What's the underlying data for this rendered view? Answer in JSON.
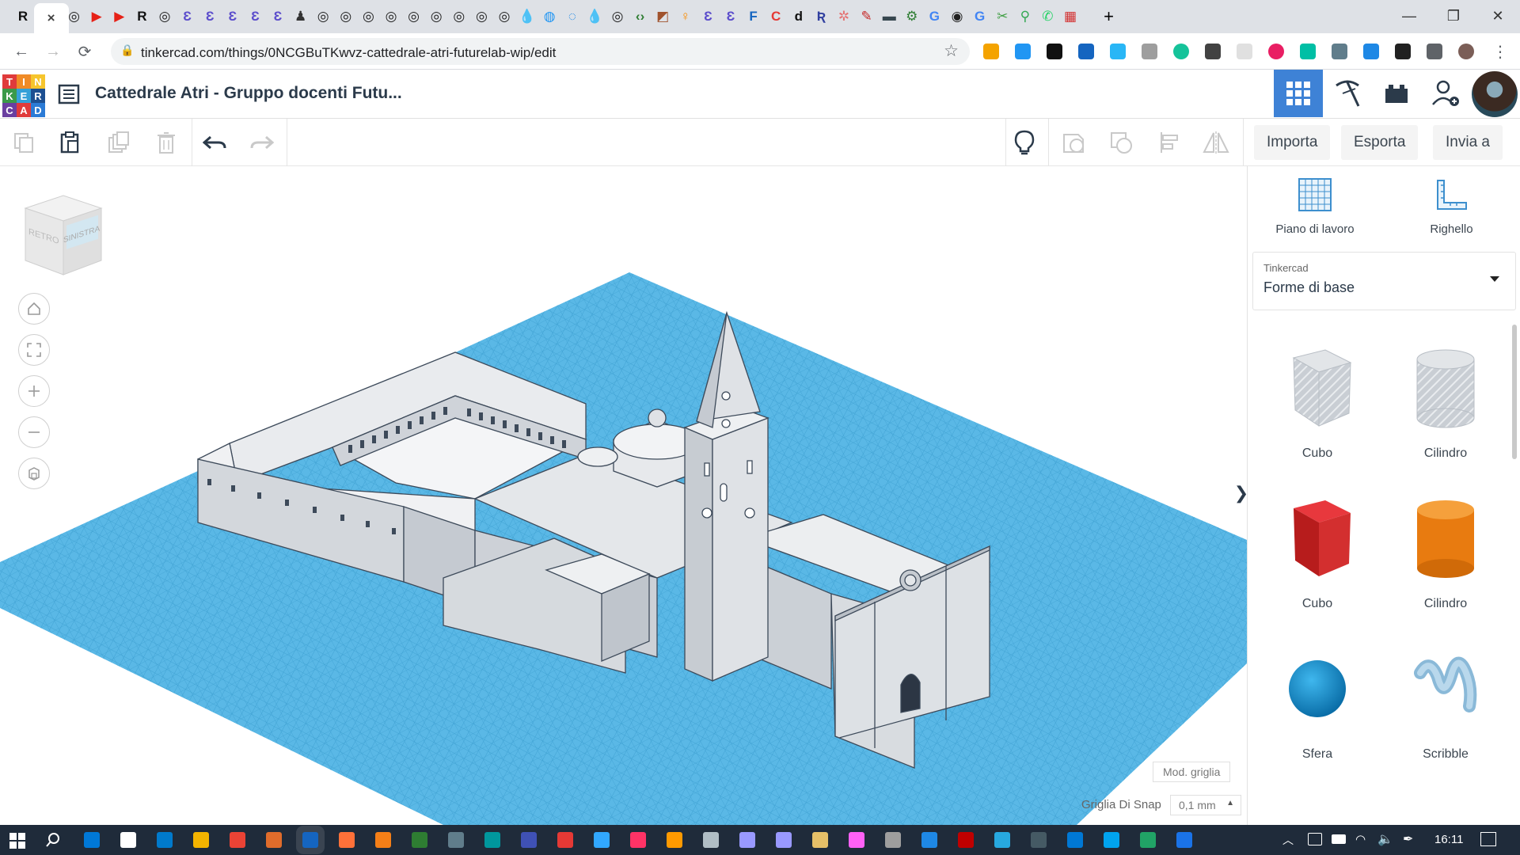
{
  "browser": {
    "tabs": [
      {
        "label": "R",
        "color": "#111111"
      },
      {
        "label": "×",
        "color": "#444444",
        "active": true
      },
      {
        "label": "◎",
        "color": "#222222"
      },
      {
        "label": "▶",
        "color": "#e62117"
      },
      {
        "label": "▶",
        "color": "#e62117"
      },
      {
        "label": "R",
        "color": "#111111"
      },
      {
        "label": "◎",
        "color": "#222222"
      },
      {
        "label": "Ɛ",
        "color": "#5b4dcc"
      },
      {
        "label": "Ɛ",
        "color": "#5b4dcc"
      },
      {
        "label": "Ɛ",
        "color": "#5b4dcc"
      },
      {
        "label": "Ɛ",
        "color": "#5b4dcc"
      },
      {
        "label": "Ɛ",
        "color": "#5b4dcc"
      },
      {
        "label": "♟",
        "color": "#333333"
      },
      {
        "label": "◎",
        "color": "#222222"
      },
      {
        "label": "◎",
        "color": "#222222"
      },
      {
        "label": "◎",
        "color": "#222222"
      },
      {
        "label": "◎",
        "color": "#222222"
      },
      {
        "label": "◎",
        "color": "#222222"
      },
      {
        "label": "◎",
        "color": "#222222"
      },
      {
        "label": "◎",
        "color": "#222222"
      },
      {
        "label": "◎",
        "color": "#222222"
      },
      {
        "label": "◎",
        "color": "#222222"
      },
      {
        "label": "💧",
        "color": "#1e88e5"
      },
      {
        "label": "◍",
        "color": "#2196f3"
      },
      {
        "label": "◌",
        "color": "#1e88e5"
      },
      {
        "label": "💧",
        "color": "#1e88e5"
      },
      {
        "label": "◎",
        "color": "#222222"
      },
      {
        "label": "‹›",
        "color": "#2e7d32"
      },
      {
        "label": "◩",
        "color": "#a0522d"
      },
      {
        "label": "♀",
        "color": "#fb8c00"
      },
      {
        "label": "Ɛ",
        "color": "#5b4dcc"
      },
      {
        "label": "Ɛ",
        "color": "#5b4dcc"
      },
      {
        "label": "F",
        "color": "#1565c0"
      },
      {
        "label": "C",
        "color": "#e53935"
      },
      {
        "label": "d",
        "color": "#111111"
      },
      {
        "label": "Ʀ",
        "color": "#303f9f"
      },
      {
        "label": "✲",
        "color": "#e57373"
      },
      {
        "label": "✎",
        "color": "#c62828"
      },
      {
        "label": "▬",
        "color": "#37474f"
      },
      {
        "label": "⚙",
        "color": "#2e7d32"
      },
      {
        "label": "G",
        "color": "#4285f4"
      },
      {
        "label": "◉",
        "color": "#212121"
      },
      {
        "label": "G",
        "color": "#4285f4"
      },
      {
        "label": "✂",
        "color": "#43a047"
      },
      {
        "label": "⚲",
        "color": "#34a853"
      },
      {
        "label": "✆",
        "color": "#25d366"
      },
      {
        "label": "▦",
        "color": "#d32f2f"
      }
    ],
    "new_tab": "+",
    "window_controls": {
      "minimize": "—",
      "restore": "❐",
      "close": "✕"
    },
    "url": "tinkercad.com/things/0NCGBuTKwvz-cattedrale-atri-futurelab-wip/edit",
    "nav": {
      "back": "←",
      "forward": "→",
      "reload": "⟳",
      "lock": "🔒",
      "star": "☆"
    }
  },
  "tinkercad": {
    "logo_letters": [
      "T",
      "I",
      "N",
      "K",
      "E",
      "R",
      "C",
      "A",
      "D"
    ],
    "logo_colors": [
      "#e03b3b",
      "#f08b27",
      "#f6c52d",
      "#3b9a49",
      "#34a0d8",
      "#1d4f91",
      "#6a3fa0",
      "#e03b3b",
      "#2b7bd6"
    ],
    "design_title": "Cattedrale Atri - Gruppo docenti Futu...",
    "toolbar": {
      "import": "Importa",
      "export": "Esporta",
      "send": "Invia a"
    },
    "viewcube": {
      "back": "RETRO",
      "left": "SINISTRA"
    },
    "workspace": {
      "grid_mode": "Mod. griglia",
      "snap_label": "Griglia Di Snap",
      "snap_value": "0,1 mm",
      "collapse_arrow": "❯"
    },
    "panel": {
      "workplane_label": "Piano di lavoro",
      "ruler_label": "Righello",
      "category_small": "Tinkercad",
      "category": "Forme di base",
      "shapes": [
        {
          "name": "Cubo",
          "type": "cube-hole"
        },
        {
          "name": "Cilindro",
          "type": "cylinder-hole"
        },
        {
          "name": "Cubo",
          "type": "cube"
        },
        {
          "name": "Cilindro",
          "type": "cylinder"
        },
        {
          "name": "Sfera",
          "type": "sphere"
        },
        {
          "name": "Scribble",
          "type": "scribble"
        }
      ]
    }
  },
  "taskbar": {
    "clock": "16:11",
    "icons": [
      "#0078d7",
      "#ffffff",
      "#007acc",
      "#f4b400",
      "#ea4335",
      "#e06c2b",
      "#1565c0",
      "#ff7139",
      "#f57f17",
      "#2e7d32",
      "#607d8b",
      "#00979d",
      "#3f51b5",
      "#e53935",
      "#31a8ff",
      "#ff3366",
      "#ff9a00",
      "#b0bec5",
      "#9999ff",
      "#9999ff",
      "#e6c068",
      "#ff61f6",
      "#9e9e9e",
      "#1e88e5",
      "#bf0000",
      "#27a9e0",
      "#455a64",
      "#0078d4",
      "#00a4ef",
      "#21a366",
      "#1a73e8"
    ]
  }
}
